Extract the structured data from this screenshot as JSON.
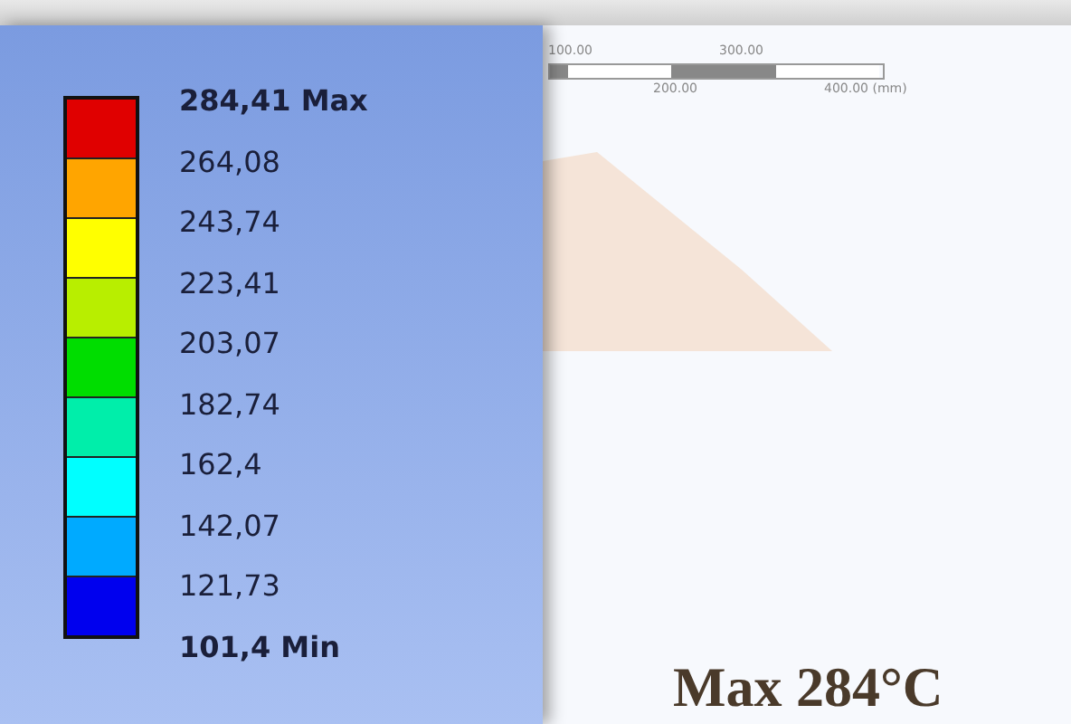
{
  "legend": {
    "entries": [
      {
        "label": "284,41 Max",
        "color": "#e00000",
        "bold": true
      },
      {
        "label": "264,08",
        "color": "#ffa500",
        "bold": false
      },
      {
        "label": "243,74",
        "color": "#ffff00",
        "bold": false
      },
      {
        "label": "223,41",
        "color": "#b8ee00",
        "bold": false
      },
      {
        "label": "203,07",
        "color": "#00dd00",
        "bold": false
      },
      {
        "label": "182,74",
        "color": "#00eeaa",
        "bold": false
      },
      {
        "label": "162,4",
        "color": "#00ffff",
        "bold": false
      },
      {
        "label": "142,07",
        "color": "#00aaff",
        "bold": false
      },
      {
        "label": "121,73",
        "color": "#0000ee",
        "bold": false
      },
      {
        "label": "101,4 Min",
        "bold": true
      }
    ]
  },
  "scale_bar": {
    "top_labels": [
      "100.00",
      "300.00"
    ],
    "bottom_labels": [
      "200.00",
      "400.00 (mm)"
    ]
  },
  "caption": "Max 284°C"
}
